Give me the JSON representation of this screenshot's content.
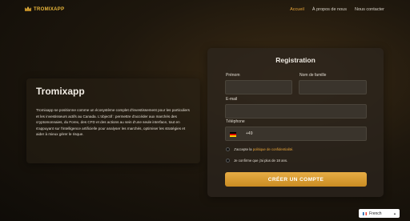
{
  "brand": {
    "logo_text": "TROMIXAPP"
  },
  "nav": {
    "items": [
      {
        "label": "Accueil",
        "active": true
      },
      {
        "label": "À propos de nous",
        "active": false
      },
      {
        "label": "Nous contacter",
        "active": false
      }
    ]
  },
  "intro": {
    "title": "Tromixapp",
    "body": "Tromixapp se positionne comme un écosystème complet d'investissement pour les particuliers et les investisseurs actifs au Canada. L'objectif : permettre d'accéder aux marchés des cryptomonnaies, du Forex, des CFD et des actions au sein d'une seule interface, tout en s'appuyant sur l'intelligence artificielle pour analyser les marchés, optimiser les stratégies et aider à mieux gérer le risque."
  },
  "registration": {
    "title": "Registration",
    "first_name_label": "Prénom",
    "first_name_value": "",
    "last_name_label": "Nom de famille",
    "last_name_value": "",
    "email_label": "E-mail",
    "email_value": "",
    "phone_label": "Téléphone",
    "phone_prefix": "+49",
    "terms_text": "J'accepte la",
    "terms_link": "politique de confidentialité.",
    "age_text": "Je confirme que j'ai plus de 18 ans.",
    "submit_label": "CRÉER UN COMPTE"
  },
  "language": {
    "selected": "French",
    "flag_icon": "france-flag-icon"
  },
  "colors": {
    "accent": "#e8a53a",
    "button": "#d99a30",
    "background": "#1e170d"
  }
}
